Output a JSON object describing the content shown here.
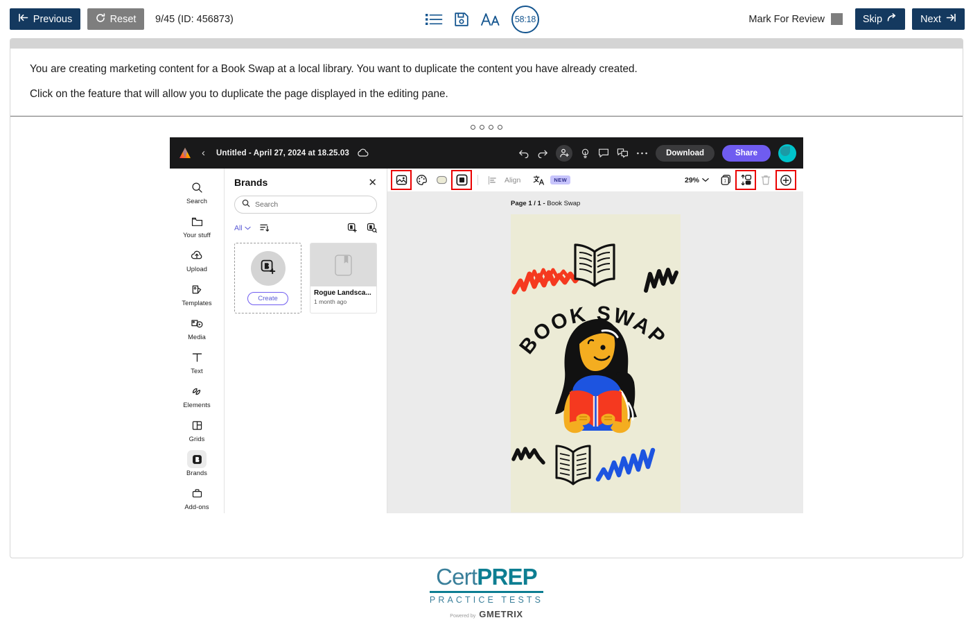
{
  "exam_bar": {
    "previous_label": "Previous",
    "reset_label": "Reset",
    "counter": "9/45 (ID: 456873)",
    "timer": "58:18",
    "mark_for_review_label": "Mark For Review",
    "skip_label": "Skip",
    "next_label": "Next",
    "icons": {
      "list": "list-icon",
      "save": "save-icon",
      "font_size": "font-size-icon",
      "timer": "timer-icon"
    },
    "colors": {
      "navy": "#14395f",
      "gray": "#7e7e7e",
      "timer_blue": "#14558f"
    }
  },
  "question": {
    "line1": "You are creating marketing content for a Book Swap at a local library. You want to duplicate the content you have already created.",
    "line2": "Click on the feature that will allow you to duplicate the page displayed in the editing pane.",
    "dots_count": 4
  },
  "canva": {
    "topbar": {
      "doc_title": "Untitled - April 27, 2024 at 18.25.03",
      "download_label": "Download",
      "share_label": "Share",
      "icons": [
        "canva-logo-icon",
        "back-chevron-icon",
        "cloud-saved-icon",
        "undo-icon",
        "redo-icon",
        "add-collaborator-icon",
        "ideas-bulb-icon",
        "comment-icon",
        "duplicate-pane-icon",
        "more-options-icon",
        "account-avatar-icon"
      ]
    },
    "rail": {
      "items": [
        {
          "label": "Search",
          "icon": "search-icon",
          "active": false
        },
        {
          "label": "Your stuff",
          "icon": "folder-icon",
          "active": false
        },
        {
          "label": "Upload",
          "icon": "upload-cloud-icon",
          "active": false
        },
        {
          "label": "Templates",
          "icon": "templates-icon",
          "active": false
        },
        {
          "label": "Media",
          "icon": "media-icon",
          "active": false
        },
        {
          "label": "Text",
          "icon": "text-icon",
          "active": false
        },
        {
          "label": "Elements",
          "icon": "elements-icon",
          "active": false
        },
        {
          "label": "Grids",
          "icon": "grids-icon",
          "active": false
        },
        {
          "label": "Brands",
          "icon": "brands-icon",
          "active": true
        },
        {
          "label": "Add-ons",
          "icon": "addons-icon",
          "active": false
        }
      ]
    },
    "panel": {
      "title": "Brands",
      "close_icon": "close-icon",
      "search_placeholder": "Search",
      "filter_all": "All",
      "sort_icon": "sort-icon",
      "new_brand_icon": "new-brand-icon",
      "find_brand_icon": "find-brand-icon",
      "create_label": "Create",
      "cards": [
        {
          "name": "Rogue Landsca...",
          "date": "1 month ago"
        }
      ]
    },
    "toolbar": {
      "items": [
        {
          "name": "image-effects-icon",
          "highlighted": true
        },
        {
          "name": "color-palette-icon",
          "highlighted": false
        },
        {
          "name": "shape-fill-icon",
          "highlighted": false
        },
        {
          "name": "frame-border-icon",
          "highlighted": true
        }
      ],
      "align_label": "Align",
      "align_icon": "align-icon",
      "translate_icon": "translate-icon",
      "new_badge": "NEW",
      "zoom": "29%",
      "zoom_caret_icon": "chevron-down-icon",
      "right_items": [
        {
          "name": "pages-count-icon",
          "highlighted": false
        },
        {
          "name": "duplicate-page-icon",
          "highlighted": true
        },
        {
          "name": "delete-page-icon",
          "highlighted": false
        },
        {
          "name": "add-page-icon",
          "highlighted": true
        }
      ]
    },
    "canvas": {
      "page_label_bold": "Page 1 / 1 -",
      "page_label_rest": " Book Swap",
      "design_title": "BOOK SWAP",
      "page_bg": "#ecebd6"
    }
  },
  "footer": {
    "logo_cert": "Cert",
    "logo_prep": "PREP",
    "logo_sub": "PRACTICE TESTS",
    "powered_by": "Powered by",
    "gmetrix": "GMETRIX"
  }
}
